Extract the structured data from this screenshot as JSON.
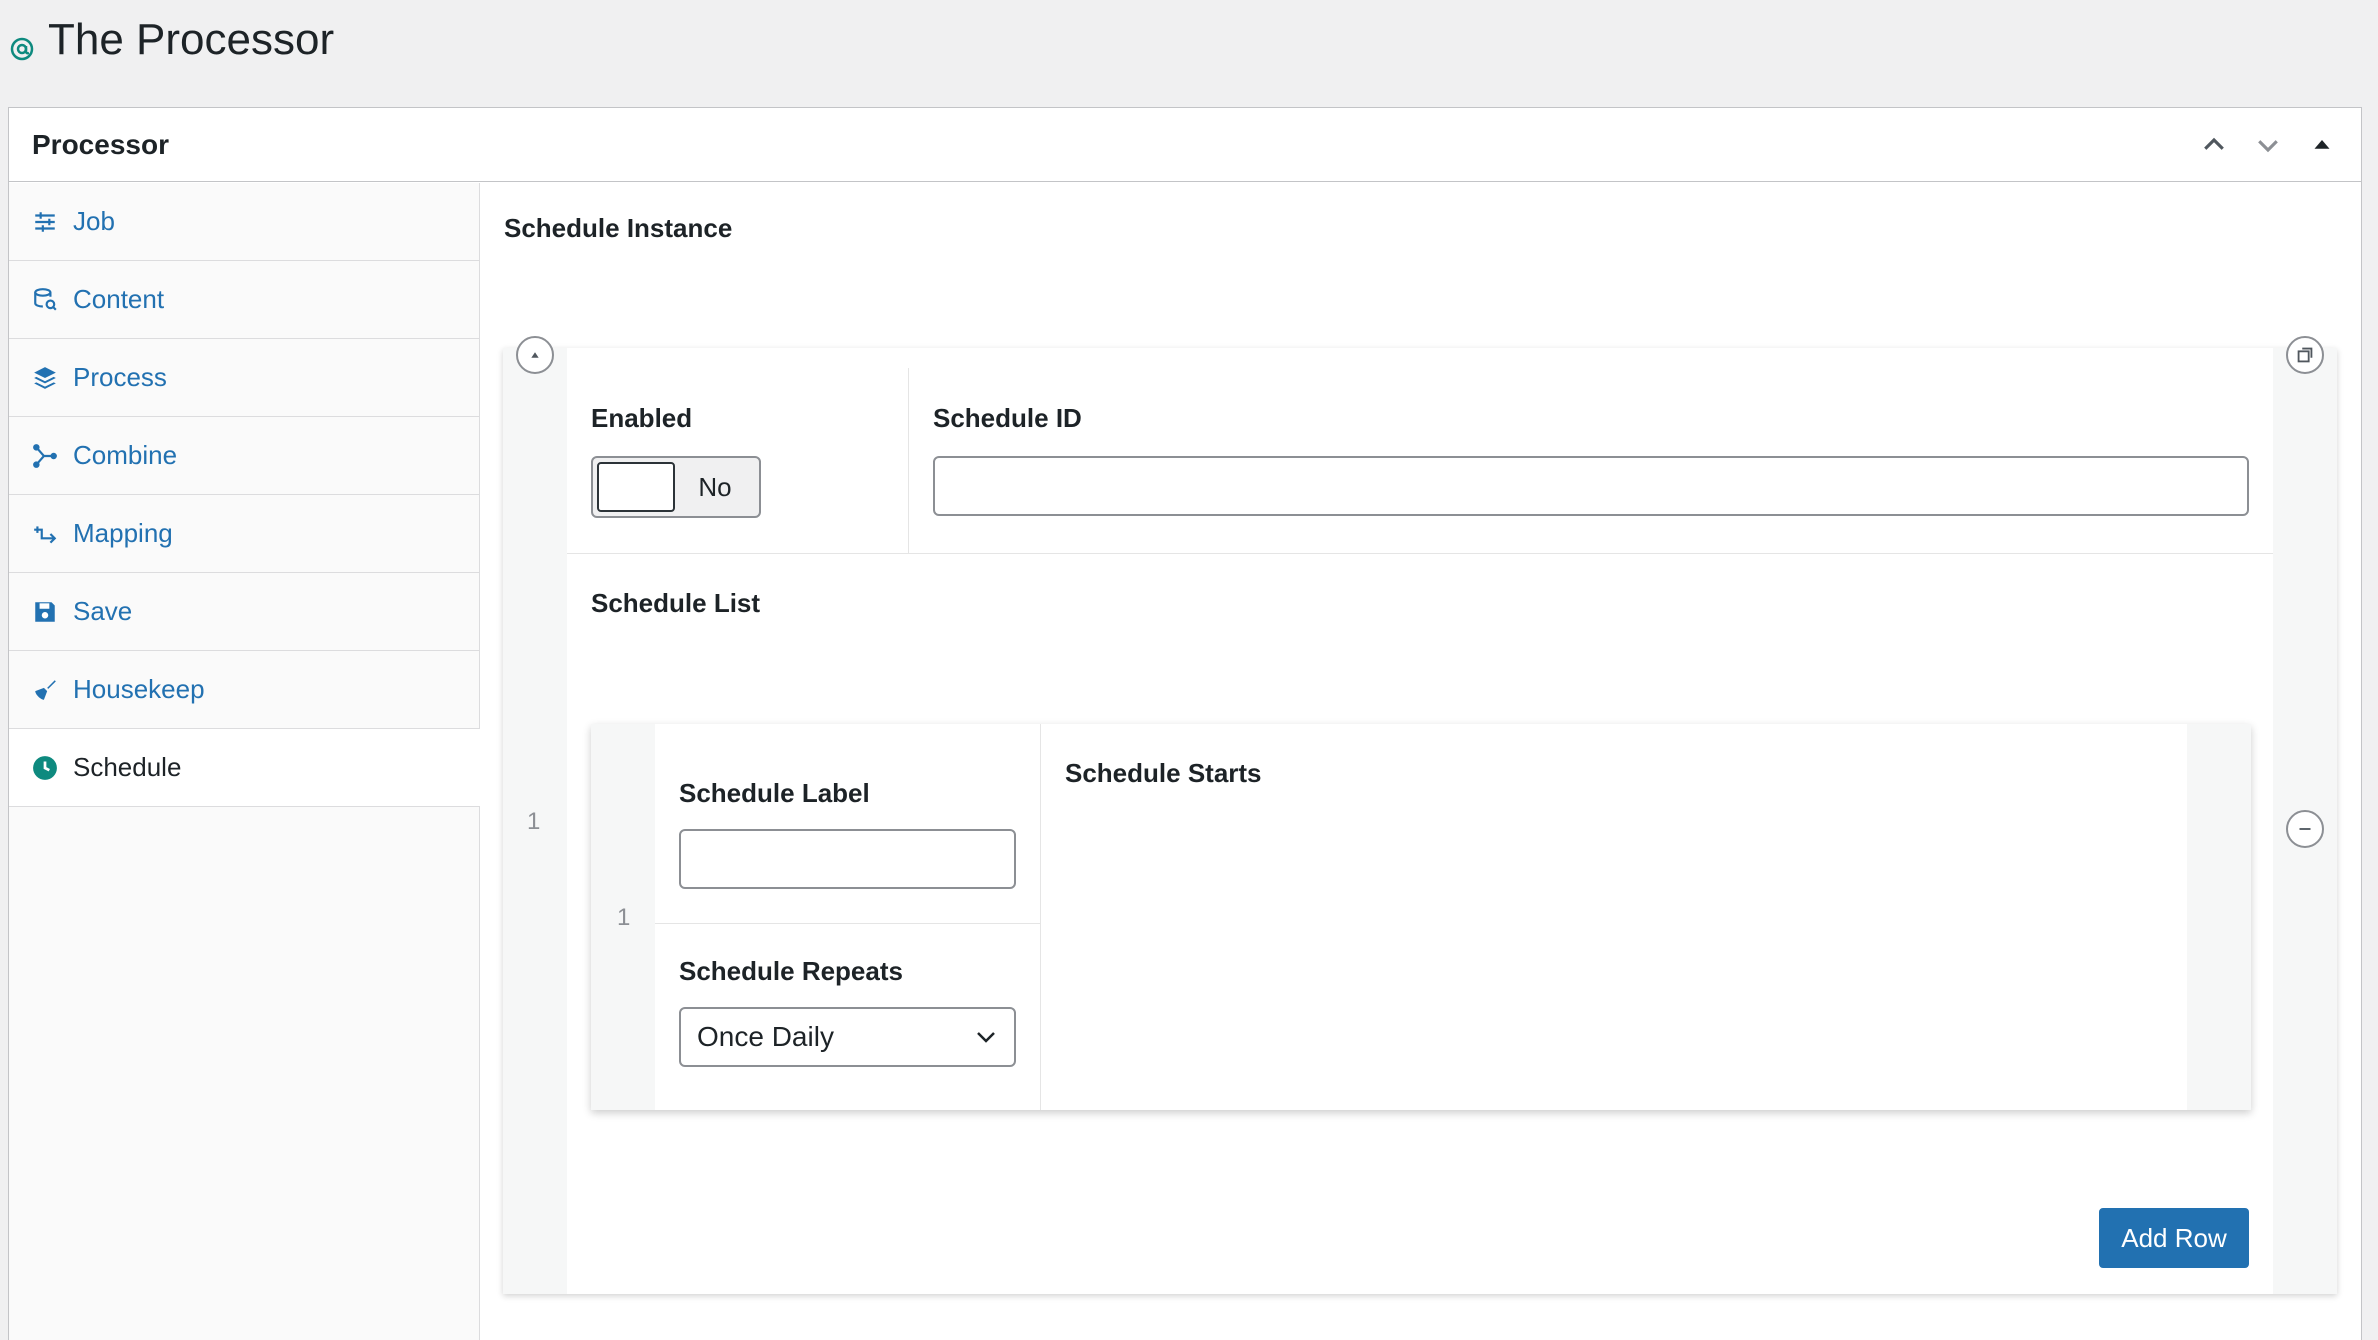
{
  "page": {
    "title": "The Processor",
    "logo_icon": "at-sign-icon"
  },
  "postbox": {
    "title": "Processor",
    "actions": [
      "move-up-icon",
      "move-down-icon",
      "toggle-panel-icon"
    ]
  },
  "tabs": [
    {
      "label": "Job",
      "icon": "sliders-icon",
      "active": false
    },
    {
      "label": "Content",
      "icon": "database-search-icon",
      "active": false
    },
    {
      "label": "Process",
      "icon": "layers-icon",
      "active": false
    },
    {
      "label": "Combine",
      "icon": "merge-icon",
      "active": false
    },
    {
      "label": "Mapping",
      "icon": "mapping-icon",
      "active": false
    },
    {
      "label": "Save",
      "icon": "floppy-disk-icon",
      "active": false
    },
    {
      "label": "Housekeep",
      "icon": "broom-icon",
      "active": false
    },
    {
      "label": "Schedule",
      "icon": "clock-icon",
      "active": true
    }
  ],
  "panel": {
    "section_label": "Schedule Instance",
    "row_index": "1",
    "enabled": {
      "label": "Enabled",
      "value": "No"
    },
    "schedule_id": {
      "label": "Schedule ID",
      "value": ""
    },
    "schedule_list": {
      "label": "Schedule List",
      "row_index": "1",
      "schedule_label": {
        "label": "Schedule Label",
        "value": ""
      },
      "schedule_repeats": {
        "label": "Schedule Repeats",
        "value": "Once Daily"
      },
      "schedule_starts": {
        "label": "Schedule Starts"
      }
    },
    "add_row_label": "Add Row"
  },
  "colors": {
    "accent": "#2271b1",
    "brand_icon": "#0e8a7f",
    "border": "#c3c4c7"
  }
}
